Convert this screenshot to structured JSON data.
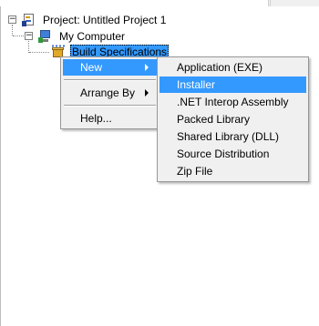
{
  "tree": {
    "project": {
      "label": "Project: Untitled Project 1",
      "expander": "−",
      "icon": "project-icon"
    },
    "computer": {
      "label": "My Computer",
      "expander": "−",
      "icon": "computer-icon"
    },
    "build_specs": {
      "label": "Build Specifications",
      "icon": "build-specifications-icon",
      "selected": true
    }
  },
  "context_menu": {
    "items": [
      {
        "label": "New",
        "has_submenu": true,
        "highlighted": true
      },
      {
        "label": "Arrange By",
        "has_submenu": true,
        "highlighted": false
      },
      {
        "label": "Help...",
        "has_submenu": false,
        "highlighted": false
      }
    ]
  },
  "submenu": {
    "items": [
      {
        "label": "Application (EXE)",
        "highlighted": false
      },
      {
        "label": "Installer",
        "highlighted": true
      },
      {
        "label": ".NET Interop Assembly",
        "highlighted": false
      },
      {
        "label": "Packed Library",
        "highlighted": false
      },
      {
        "label": "Shared Library (DLL)",
        "highlighted": false
      },
      {
        "label": "Source Distribution",
        "highlighted": false
      },
      {
        "label": "Zip File",
        "highlighted": false
      }
    ]
  },
  "colors": {
    "selection": "#3399ff",
    "menu_background": "#f0f0f0"
  }
}
